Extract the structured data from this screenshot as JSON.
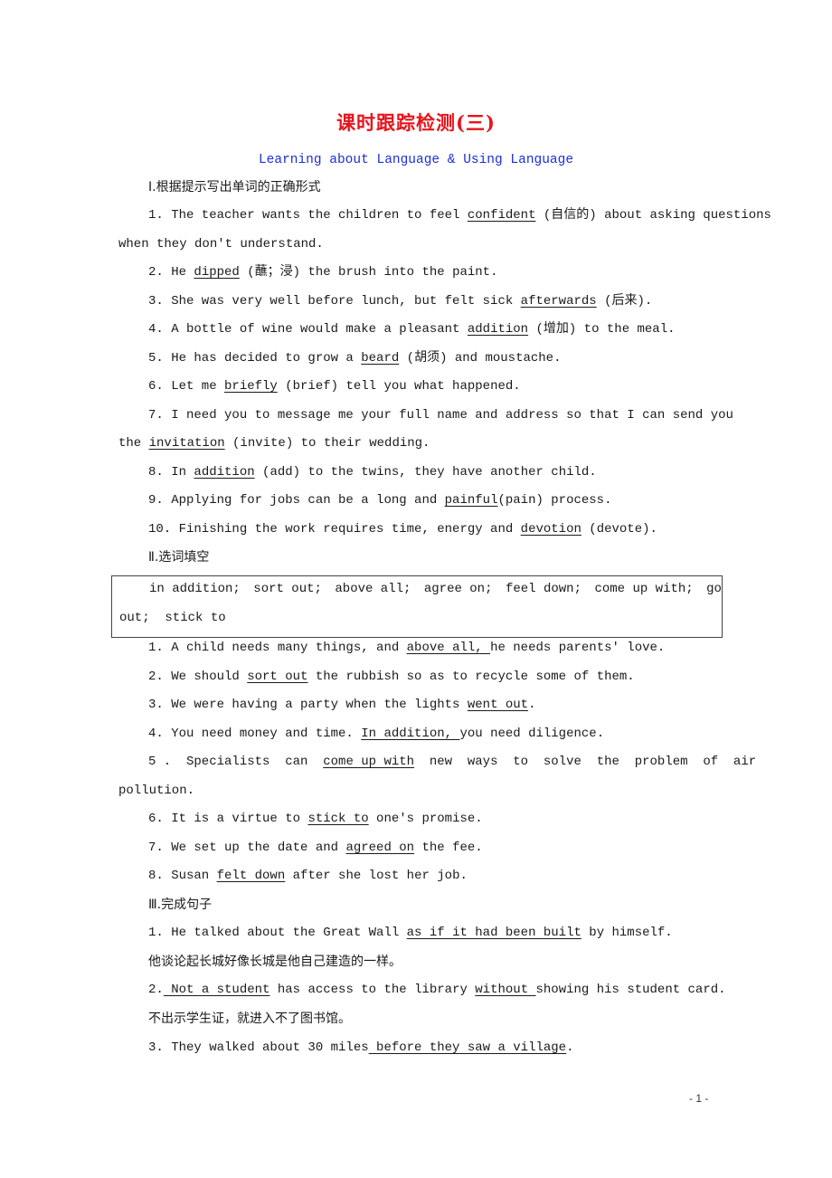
{
  "title": "课时跟踪检测(三)",
  "subtitle": "Learning about Language & Using Language",
  "section1": {
    "heading": "Ⅰ.根据提示写出单词的正确形式",
    "items": [
      {
        "pre": "1. The teacher wants the children to feel ",
        "answer": "confident",
        "post": " (自信的) about asking questions",
        "cont": "when they don't understand."
      },
      {
        "pre": "2. He ",
        "answer": "dipped",
        "post": " (蘸；浸) the brush into the paint."
      },
      {
        "pre": "3. She was very well before lunch, but felt sick ",
        "answer": "afterwards",
        "post": " (后来)."
      },
      {
        "pre": "4. A bottle of wine would make a pleasant ",
        "answer": "addition",
        "post": " (增加) to the meal."
      },
      {
        "pre": "5. He has decided to grow a ",
        "answer": "beard",
        "post": " (胡须) and moustache."
      },
      {
        "pre": "6. Let me ",
        "answer": "briefly",
        "post": " (brief) tell you what happened."
      },
      {
        "pre": "7. I need you to message me your full name and address so that I can send you",
        "cont_pre": "the ",
        "answer": "invitation",
        "post": " (invite) to their wedding."
      },
      {
        "pre": "8. In ",
        "answer": "addition",
        "post": " (add) to the twins, they have another child."
      },
      {
        "pre": "9. Applying for jobs can be a long and ",
        "answer": "painful",
        "post": "(pain) process."
      },
      {
        "pre": "10. Finishing the work requires time, energy and ",
        "answer": "devotion",
        "post": " (devote)."
      }
    ]
  },
  "section2": {
    "heading": "Ⅱ.选词填空",
    "word_box": {
      "line1": [
        "in addition;",
        "sort out;",
        "above all;",
        "agree on;",
        "feel down;",
        "come up with;",
        "go"
      ],
      "line2": "out;  stick to"
    },
    "items": [
      {
        "pre": "1. A child needs many things, and ",
        "answer": "above all, ",
        "post": "he needs parents' love."
      },
      {
        "pre": "2. We should ",
        "answer": "sort out",
        "post": " the rubbish so as to recycle some of them."
      },
      {
        "pre": "3. We were having a party when the lights ",
        "answer": "went out",
        "post": "."
      },
      {
        "pre": "4. You need money and time. ",
        "answer": "In addition, ",
        "post": "you need diligence."
      },
      {
        "pre": "5 .  Specialists  can  ",
        "answer": "come up with",
        "post": "  new  ways  to  solve  the  problem  of  air",
        "cont": "pollution."
      },
      {
        "pre": "6. It is a virtue to ",
        "answer": "stick to",
        "post": " one's promise."
      },
      {
        "pre": "7. We set up the date and ",
        "answer": "agreed on",
        "post": " the fee."
      },
      {
        "pre": "8. Susan ",
        "answer": "felt down",
        "post": " after she lost her job."
      }
    ]
  },
  "section3": {
    "heading": "Ⅲ.完成句子",
    "items": [
      {
        "pre": "1. He talked about the Great Wall ",
        "answer": "as if it had been built",
        "post": " by himself.",
        "translation": "他谈论起长城好像长城是他自己建造的一样。"
      },
      {
        "pre": "2.",
        "answer": " Not a student",
        "mid": " has access to the library ",
        "answer2": "without ",
        "post": "showing his student card.",
        "translation": "不出示学生证，就进入不了图书馆。"
      },
      {
        "pre": "3. They walked about 30 miles",
        "answer": " before they saw a village",
        "post": "."
      }
    ]
  },
  "page_number": "- 1 -",
  "colors": {
    "title": "#e8141c",
    "subtitle": "#1c2fd6",
    "text": "#1a1a1a"
  }
}
